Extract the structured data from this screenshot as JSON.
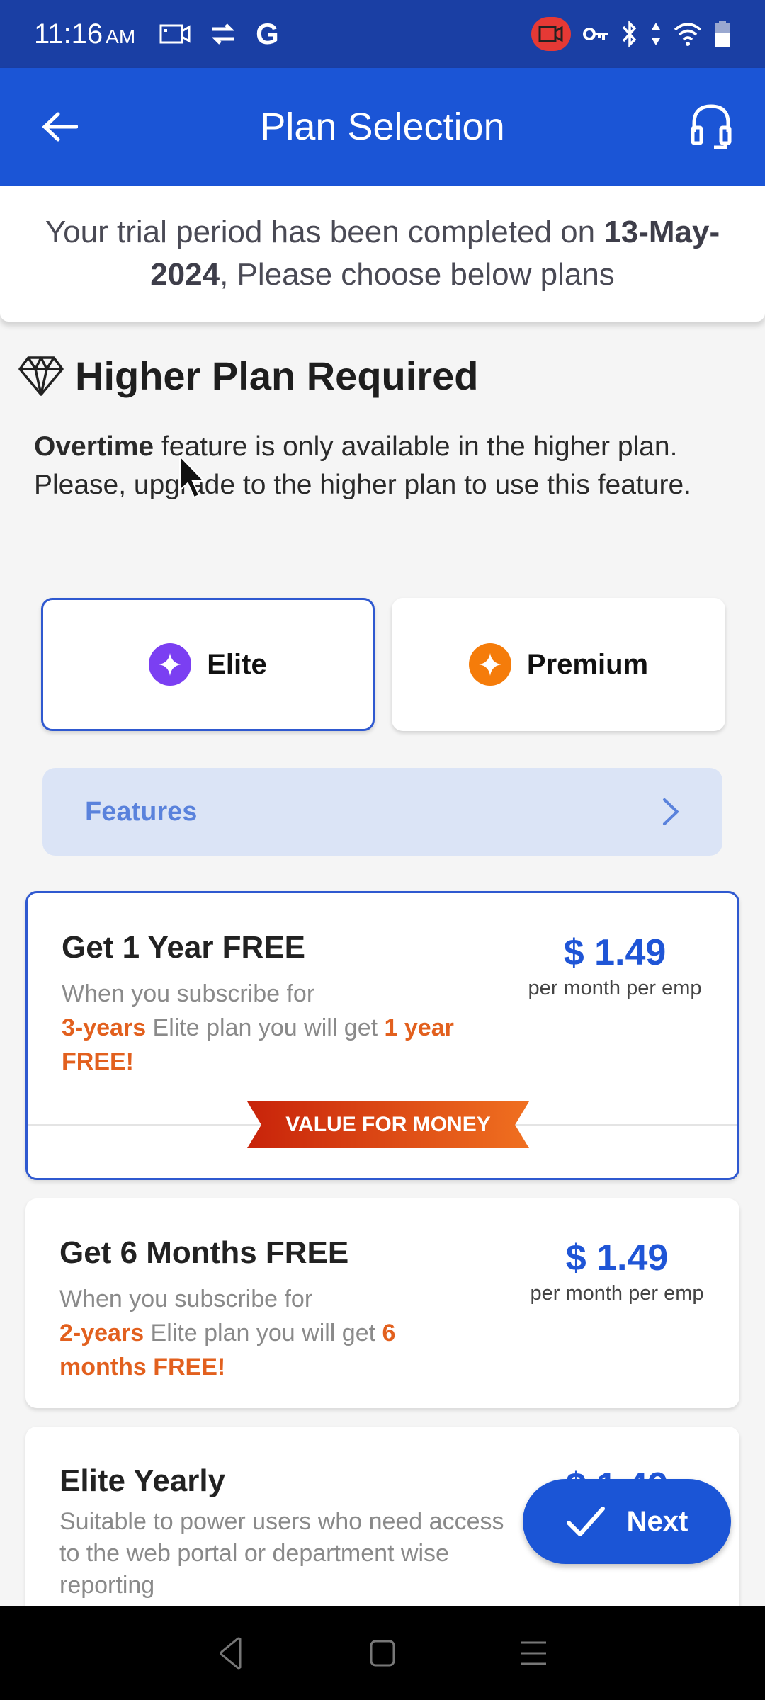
{
  "status_bar": {
    "time": "11:16",
    "ampm": "AM",
    "left_icons": [
      "screen-record-icon",
      "sync-icon",
      "google-icon"
    ],
    "right_icons": [
      "recording-indicator-icon",
      "vpn-key-icon",
      "bluetooth-icon",
      "data-arrows-icon",
      "wifi-icon",
      "battery-icon"
    ]
  },
  "app_bar": {
    "title": "Plan Selection",
    "back_icon": "arrow-left-icon",
    "support_icon": "headset-icon"
  },
  "trial_banner": {
    "text_prefix": "Your trial period has been completed on ",
    "date": "13-May-2024",
    "text_suffix": ", Please choose below plans"
  },
  "higher_plan": {
    "icon": "diamond-icon",
    "title": "Higher Plan Required",
    "feature_name": "Overtime",
    "desc_rest": " feature is only available in the higher plan. Please, upgrade to the higher plan to use this feature."
  },
  "plan_tabs": [
    {
      "label": "Elite",
      "selected": true,
      "color": "#7b3ff2",
      "icon": "sparkle-icon"
    },
    {
      "label": "Premium",
      "selected": false,
      "color": "#f57c0a",
      "icon": "sparkle-icon"
    }
  ],
  "features": {
    "label": "Features",
    "icon": "chevron-right-icon"
  },
  "offers": [
    {
      "title": "Get 1 Year FREE",
      "desc_lead": "When you subscribe for",
      "hl1": "3-years",
      "desc_mid": " Elite plan you will get ",
      "hl2": "1 year FREE!",
      "price": "$ 1.49",
      "price_unit": "per month per emp",
      "ribbon": "VALUE FOR MONEY",
      "selected": true
    },
    {
      "title": "Get 6 Months FREE",
      "desc_lead": "When you subscribe for",
      "hl1": "2-years",
      "desc_mid": " Elite plan you will get ",
      "hl2": "6 months FREE!",
      "price": "$ 1.49",
      "price_unit": "per month per emp",
      "selected": false
    },
    {
      "title": "Elite Yearly",
      "desc": "Suitable to power users who need access to the web portal or department wise reporting",
      "price": "$ 1.49",
      "selected": false
    }
  ],
  "next_button": {
    "label": "Next",
    "icon": "checkmark-icon"
  },
  "nav_bar": {
    "icons": [
      "nav-back-icon",
      "nav-home-icon",
      "nav-menu-icon"
    ]
  },
  "colors": {
    "primary": "#1b55d6",
    "status_bar": "#1a3fa4",
    "highlight": "#e2601e",
    "elite": "#7b3ff2",
    "premium": "#f57c0a"
  }
}
